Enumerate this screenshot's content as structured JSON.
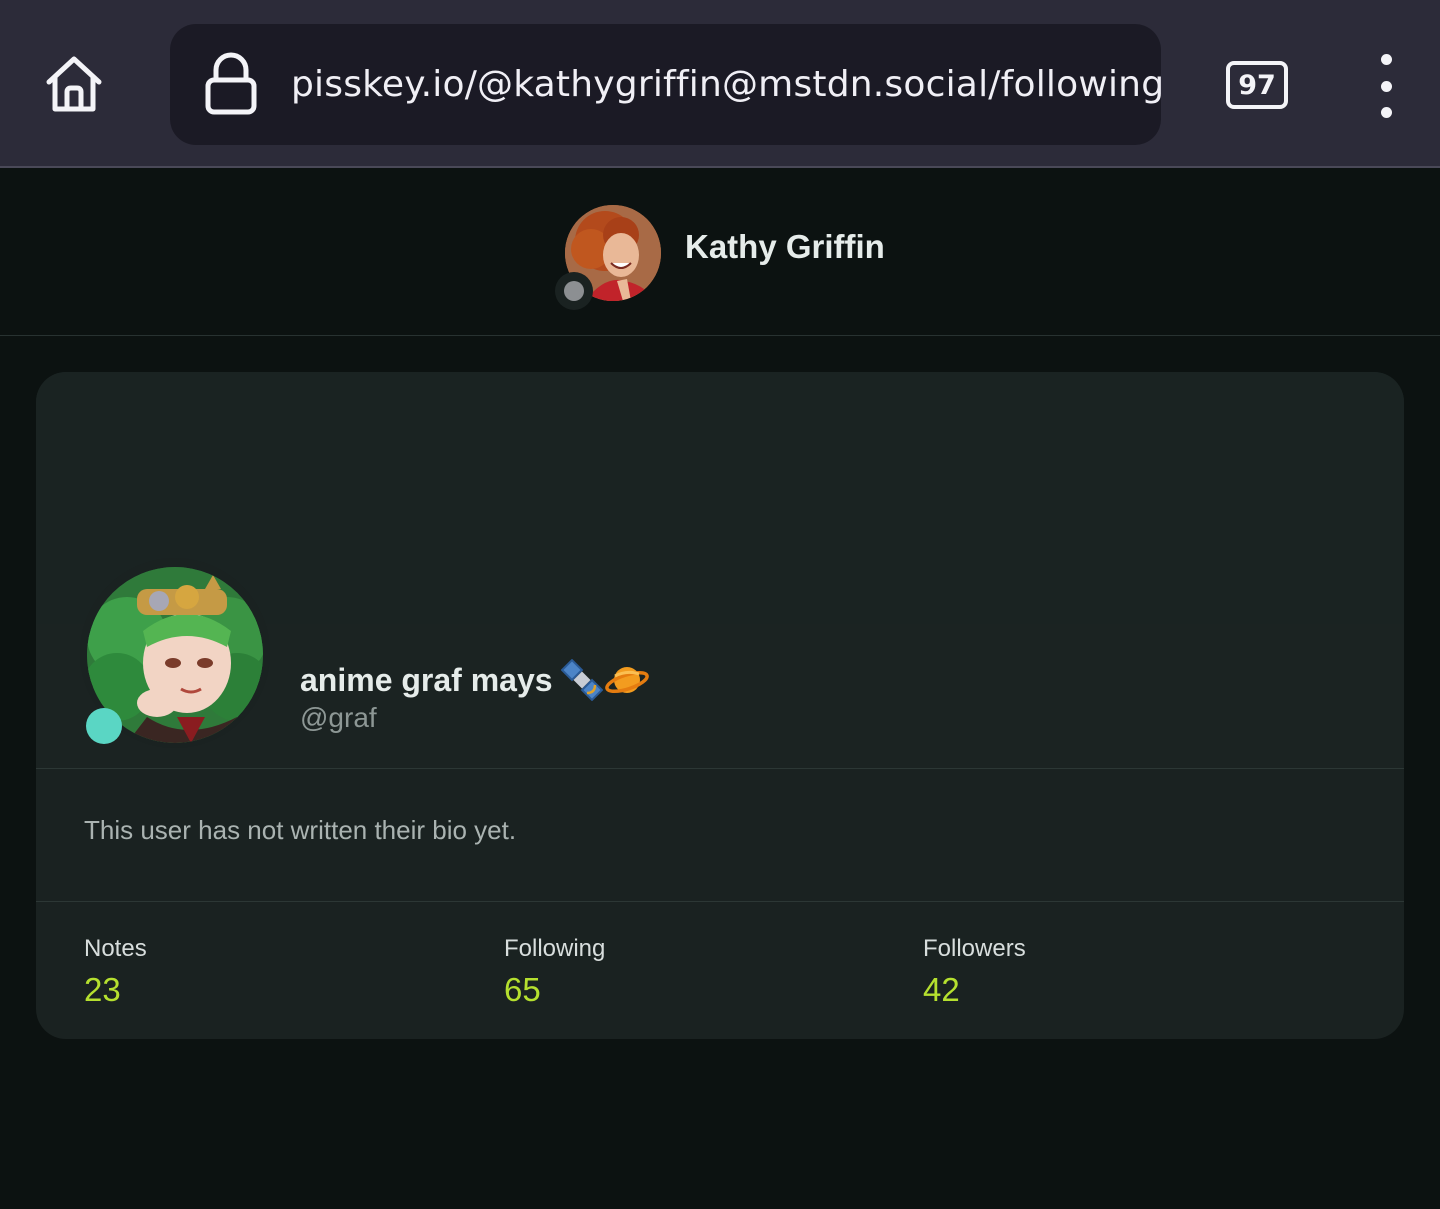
{
  "browser": {
    "url": "pisskey.io/@kathygriffin@mstdn.social/following",
    "tab_count": "97",
    "icons": {
      "home": "home-icon",
      "lock": "lock-icon",
      "menu": "kebab-menu-icon"
    }
  },
  "header": {
    "profile_name": "Kathy Griffin",
    "avatar": "user-avatar-photo",
    "status": "offline"
  },
  "user_card": {
    "display_name": "anime graf mays",
    "name_emojis": [
      "satellite-emoji",
      "ringed-planet-emoji"
    ],
    "username": "@graf",
    "avatar": "anime-avatar",
    "status": "online",
    "bio": "This user has not written their bio yet.",
    "stats": [
      {
        "label": "Notes",
        "value": "23"
      },
      {
        "label": "Following",
        "value": "65"
      },
      {
        "label": "Followers",
        "value": "42"
      }
    ]
  },
  "colors": {
    "accent": "#b5e02f",
    "online": "#5ad6c4",
    "offline": "#8c8f92",
    "background": "#0c1211",
    "card": "#1a2221"
  }
}
